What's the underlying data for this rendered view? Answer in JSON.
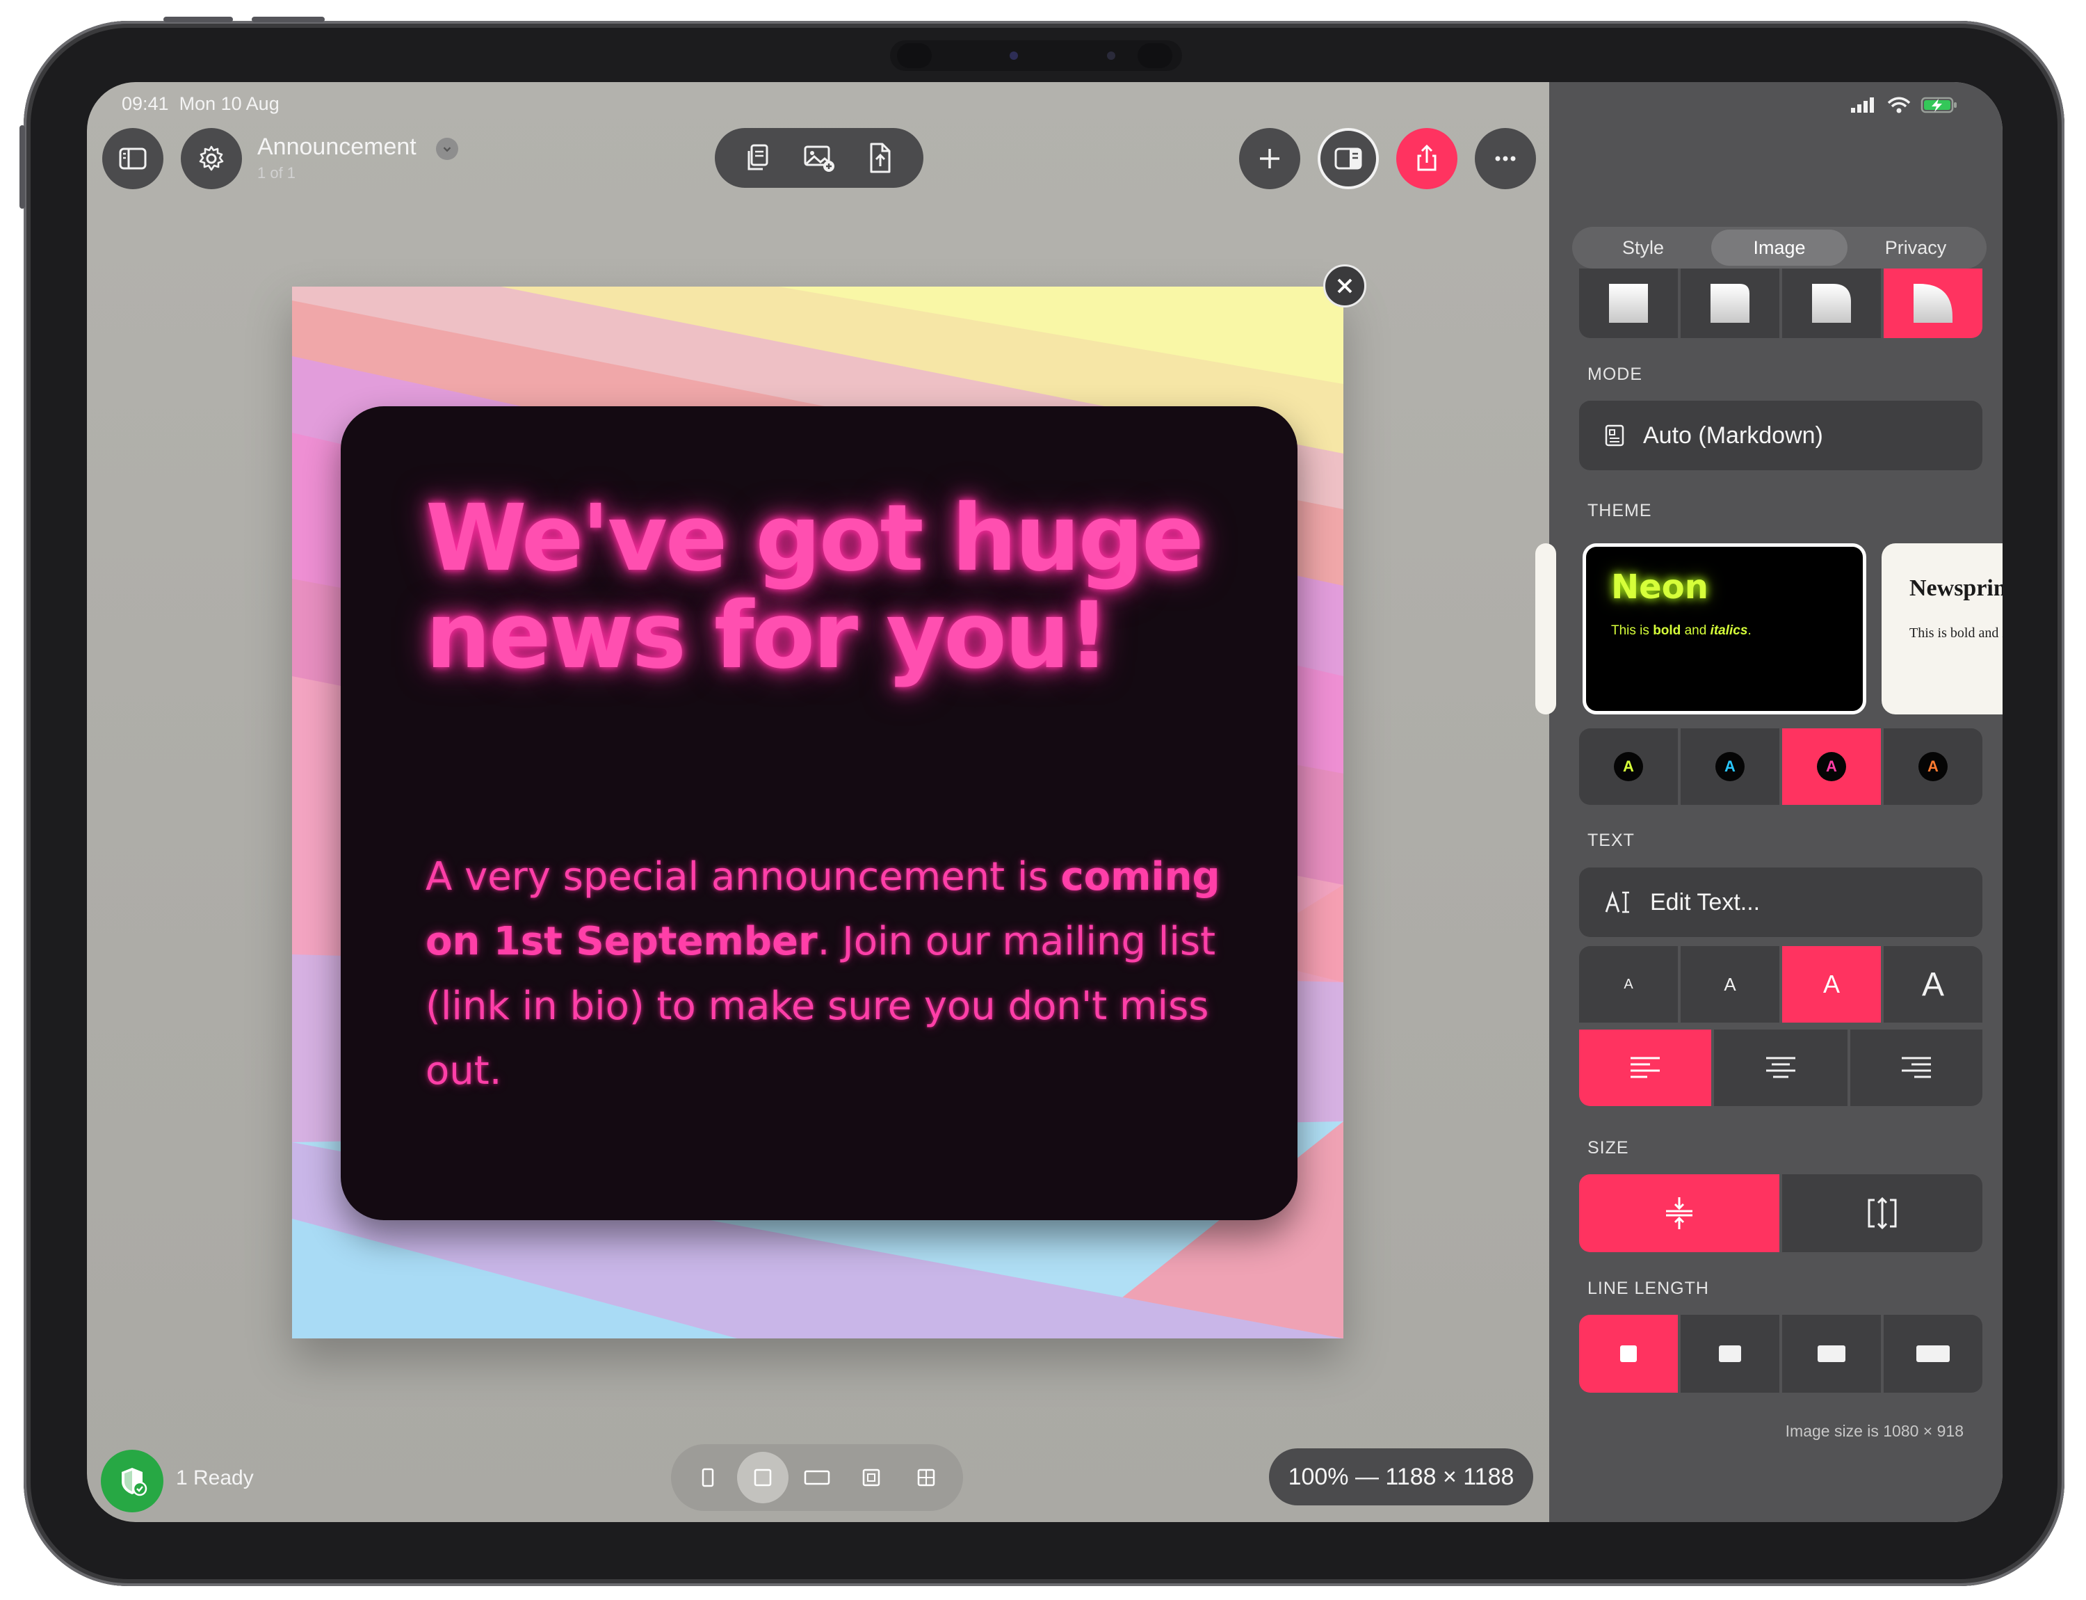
{
  "status_bar": {
    "time": "09:41",
    "date": "Mon 10 Aug"
  },
  "document": {
    "title": "Announcement",
    "page_indicator": "1 of 1"
  },
  "canvas": {
    "headline": "We've got huge news for you!",
    "body_part1": "A very special announcement is ",
    "body_bold": "coming on 1st September",
    "body_part2": ". Join our mailing list (link in bio) to make sure you don't miss out."
  },
  "bottom_bar": {
    "ready_label": "1 Ready",
    "zoom_label": "100% — 1188 × 1188"
  },
  "inspector": {
    "tabs": [
      "Style",
      "Image",
      "Privacy"
    ],
    "active_tab": "Image",
    "mode_label": "MODE",
    "mode_value": "Auto (Markdown)",
    "theme_label": "THEME",
    "theme_neon": {
      "title": "Neon",
      "sample_prefix": "This is ",
      "sample_bold": "bold",
      "sample_mid": " and ",
      "sample_italic": "italics",
      "sample_end": "."
    },
    "theme_newsprint": {
      "title": "Newsprint",
      "sample": "This is bold and italics."
    },
    "accent_swatches": [
      {
        "letter": "A",
        "color": "#d6ff3a"
      },
      {
        "letter": "A",
        "color": "#29c7ff"
      },
      {
        "letter": "A",
        "color": "#ff3fa8"
      },
      {
        "letter": "A",
        "color": "#ff7a30"
      }
    ],
    "text_label": "TEXT",
    "edit_text_label": "Edit Text...",
    "font_sizes": [
      "A",
      "A",
      "A",
      "A"
    ],
    "size_label": "SIZE",
    "line_length_label": "LINE LENGTH",
    "image_size_note": "Image size is 1080 × 918"
  },
  "colors": {
    "accent": "#ff3360",
    "neon_pink": "#ff3fa8",
    "neon_green": "#d6ff3a",
    "panel": "#535355"
  }
}
